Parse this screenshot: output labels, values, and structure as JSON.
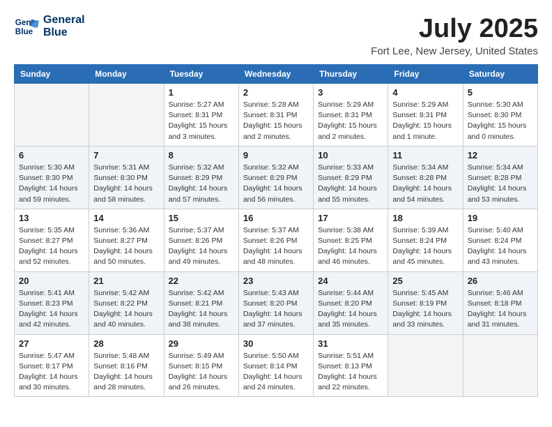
{
  "header": {
    "logo_line1": "General",
    "logo_line2": "Blue",
    "month": "July 2025",
    "location": "Fort Lee, New Jersey, United States"
  },
  "weekdays": [
    "Sunday",
    "Monday",
    "Tuesday",
    "Wednesday",
    "Thursday",
    "Friday",
    "Saturday"
  ],
  "weeks": [
    [
      {
        "day": "",
        "info": ""
      },
      {
        "day": "",
        "info": ""
      },
      {
        "day": "1",
        "info": "Sunrise: 5:27 AM\nSunset: 8:31 PM\nDaylight: 15 hours\nand 3 minutes."
      },
      {
        "day": "2",
        "info": "Sunrise: 5:28 AM\nSunset: 8:31 PM\nDaylight: 15 hours\nand 2 minutes."
      },
      {
        "day": "3",
        "info": "Sunrise: 5:29 AM\nSunset: 8:31 PM\nDaylight: 15 hours\nand 2 minutes."
      },
      {
        "day": "4",
        "info": "Sunrise: 5:29 AM\nSunset: 8:31 PM\nDaylight: 15 hours\nand 1 minute."
      },
      {
        "day": "5",
        "info": "Sunrise: 5:30 AM\nSunset: 8:30 PM\nDaylight: 15 hours\nand 0 minutes."
      }
    ],
    [
      {
        "day": "6",
        "info": "Sunrise: 5:30 AM\nSunset: 8:30 PM\nDaylight: 14 hours\nand 59 minutes."
      },
      {
        "day": "7",
        "info": "Sunrise: 5:31 AM\nSunset: 8:30 PM\nDaylight: 14 hours\nand 58 minutes."
      },
      {
        "day": "8",
        "info": "Sunrise: 5:32 AM\nSunset: 8:29 PM\nDaylight: 14 hours\nand 57 minutes."
      },
      {
        "day": "9",
        "info": "Sunrise: 5:32 AM\nSunset: 8:29 PM\nDaylight: 14 hours\nand 56 minutes."
      },
      {
        "day": "10",
        "info": "Sunrise: 5:33 AM\nSunset: 8:29 PM\nDaylight: 14 hours\nand 55 minutes."
      },
      {
        "day": "11",
        "info": "Sunrise: 5:34 AM\nSunset: 8:28 PM\nDaylight: 14 hours\nand 54 minutes."
      },
      {
        "day": "12",
        "info": "Sunrise: 5:34 AM\nSunset: 8:28 PM\nDaylight: 14 hours\nand 53 minutes."
      }
    ],
    [
      {
        "day": "13",
        "info": "Sunrise: 5:35 AM\nSunset: 8:27 PM\nDaylight: 14 hours\nand 52 minutes."
      },
      {
        "day": "14",
        "info": "Sunrise: 5:36 AM\nSunset: 8:27 PM\nDaylight: 14 hours\nand 50 minutes."
      },
      {
        "day": "15",
        "info": "Sunrise: 5:37 AM\nSunset: 8:26 PM\nDaylight: 14 hours\nand 49 minutes."
      },
      {
        "day": "16",
        "info": "Sunrise: 5:37 AM\nSunset: 8:26 PM\nDaylight: 14 hours\nand 48 minutes."
      },
      {
        "day": "17",
        "info": "Sunrise: 5:38 AM\nSunset: 8:25 PM\nDaylight: 14 hours\nand 46 minutes."
      },
      {
        "day": "18",
        "info": "Sunrise: 5:39 AM\nSunset: 8:24 PM\nDaylight: 14 hours\nand 45 minutes."
      },
      {
        "day": "19",
        "info": "Sunrise: 5:40 AM\nSunset: 8:24 PM\nDaylight: 14 hours\nand 43 minutes."
      }
    ],
    [
      {
        "day": "20",
        "info": "Sunrise: 5:41 AM\nSunset: 8:23 PM\nDaylight: 14 hours\nand 42 minutes."
      },
      {
        "day": "21",
        "info": "Sunrise: 5:42 AM\nSunset: 8:22 PM\nDaylight: 14 hours\nand 40 minutes."
      },
      {
        "day": "22",
        "info": "Sunrise: 5:42 AM\nSunset: 8:21 PM\nDaylight: 14 hours\nand 38 minutes."
      },
      {
        "day": "23",
        "info": "Sunrise: 5:43 AM\nSunset: 8:20 PM\nDaylight: 14 hours\nand 37 minutes."
      },
      {
        "day": "24",
        "info": "Sunrise: 5:44 AM\nSunset: 8:20 PM\nDaylight: 14 hours\nand 35 minutes."
      },
      {
        "day": "25",
        "info": "Sunrise: 5:45 AM\nSunset: 8:19 PM\nDaylight: 14 hours\nand 33 minutes."
      },
      {
        "day": "26",
        "info": "Sunrise: 5:46 AM\nSunset: 8:18 PM\nDaylight: 14 hours\nand 31 minutes."
      }
    ],
    [
      {
        "day": "27",
        "info": "Sunrise: 5:47 AM\nSunset: 8:17 PM\nDaylight: 14 hours\nand 30 minutes."
      },
      {
        "day": "28",
        "info": "Sunrise: 5:48 AM\nSunset: 8:16 PM\nDaylight: 14 hours\nand 28 minutes."
      },
      {
        "day": "29",
        "info": "Sunrise: 5:49 AM\nSunset: 8:15 PM\nDaylight: 14 hours\nand 26 minutes."
      },
      {
        "day": "30",
        "info": "Sunrise: 5:50 AM\nSunset: 8:14 PM\nDaylight: 14 hours\nand 24 minutes."
      },
      {
        "day": "31",
        "info": "Sunrise: 5:51 AM\nSunset: 8:13 PM\nDaylight: 14 hours\nand 22 minutes."
      },
      {
        "day": "",
        "info": ""
      },
      {
        "day": "",
        "info": ""
      }
    ]
  ]
}
